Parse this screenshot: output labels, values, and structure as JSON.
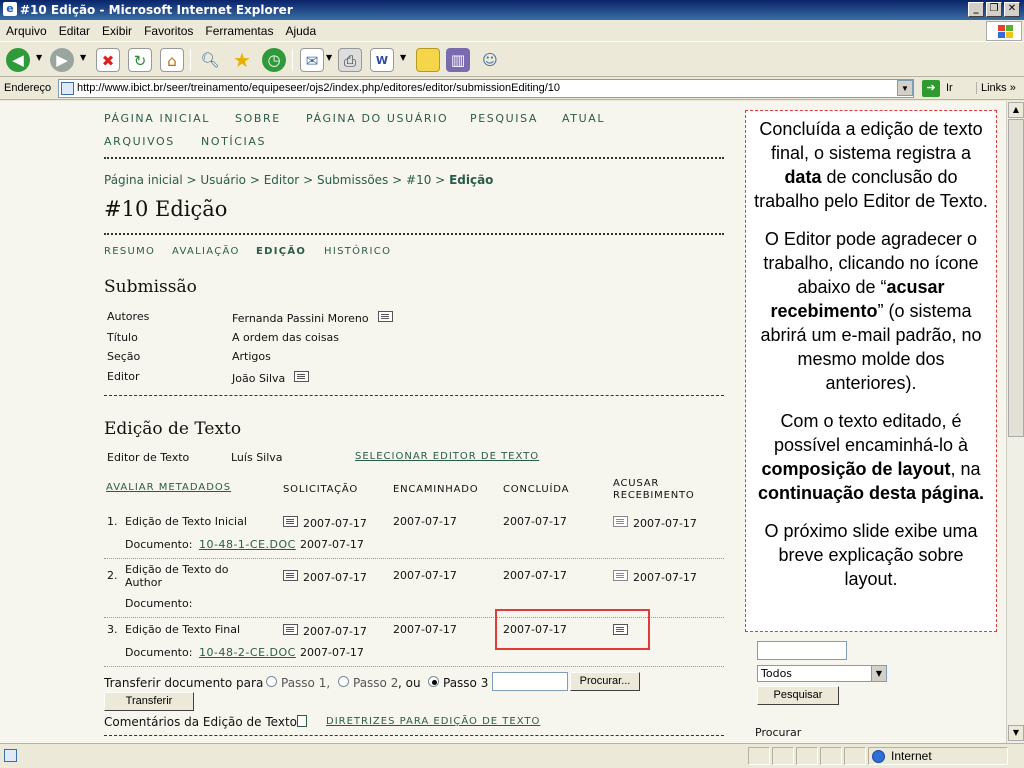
{
  "window": {
    "title": "#10 Edição - Microsoft Internet Explorer"
  },
  "menu": [
    "Arquivo",
    "Editar",
    "Exibir",
    "Favoritos",
    "Ferramentas",
    "Ajuda"
  ],
  "address": {
    "label": "Endereço",
    "url": "http://www.ibict.br/seer/treinamento/equipeseer/ojs2/index.php/editores/editor/submissionEditing/10",
    "go_label": "Ir",
    "links_label": "Links"
  },
  "nav": {
    "row1": [
      "PÁGINA INICIAL",
      "SOBRE",
      "PÁGINA DO USUÁRIO",
      "PESQUISA",
      "ATUAL"
    ],
    "row2": [
      "ARQUIVOS",
      "NOTÍCIAS"
    ]
  },
  "breadcrumb": {
    "items": [
      "Página inicial",
      "Usuário",
      "Editor",
      "Submissões",
      "#10"
    ],
    "current": "Edição",
    "sep": ">"
  },
  "page_title": "#10 Edição",
  "tabs": [
    "RESUMO",
    "AVALIAÇÃO",
    "EDIÇÃO",
    "HISTÓRICO"
  ],
  "submission": {
    "heading": "Submissão",
    "rows": [
      {
        "label": "Autores",
        "value": "Fernanda Passini Moreno"
      },
      {
        "label": "Título",
        "value": "A ordem das coisas"
      },
      {
        "label": "Seção",
        "value": "Artigos"
      },
      {
        "label": "Editor",
        "value": "João Silva"
      }
    ]
  },
  "copyedit": {
    "heading": "Edição de Texto",
    "editor_label": "Editor de Texto",
    "editor_name": "Luís Silva",
    "select_link": "SELECIONAR EDITOR DE TEXTO",
    "review_meta": "AVALIAR METADADOS",
    "columns": {
      "requested": "SOLICITAÇÃO",
      "forwarded": "ENCAMINHADO",
      "completed": "CONCLUÍDA",
      "ack1": "ACUSAR",
      "ack2": "RECEBIMENTO"
    },
    "steps": [
      {
        "num": "1.",
        "title": "Edição de Texto Inicial",
        "requested": "2007-07-17",
        "forwarded": "2007-07-17",
        "completed": "2007-07-17",
        "ack": "2007-07-17",
        "doc_label": "Documento:",
        "doc_link": "10-48-1-CE.DOC",
        "doc_date": "2007-07-17"
      },
      {
        "num": "2.",
        "title": "Edição de Texto do",
        "title2": "Author",
        "requested": "2007-07-17",
        "forwarded": "2007-07-17",
        "completed": "2007-07-17",
        "ack": "2007-07-17",
        "doc_label": "Documento:",
        "doc_link": "",
        "doc_date": ""
      },
      {
        "num": "3.",
        "title": "Edição de Texto Final",
        "requested": "2007-07-17",
        "forwarded": "2007-07-17",
        "completed": "2007-07-17",
        "ack": "",
        "doc_label": "Documento:",
        "doc_link": "10-48-2-CE.DOC",
        "doc_date": "2007-07-17"
      }
    ],
    "transfer": {
      "label": "Transferir documento para",
      "step1": "Passo 1,",
      "step2": "Passo 2",
      "or": ", ou",
      "step3": "Passo 3",
      "browse": "Procurar...",
      "button": "Transferir"
    },
    "comments_label": "Comentários da Edição de Texto",
    "guidelines_link": "DIRETRIZES PARA EDIÇÃO DE TEXTO"
  },
  "sidebar": {
    "select_value": "Todos",
    "search_button": "Pesquisar",
    "browse_heading": "Procurar"
  },
  "annotation": {
    "p1_a": "Concluída a edição de texto final, o sistema registra a ",
    "p1_b": "data",
    "p1_c": " de conclusão do trabalho pelo Editor de Texto.",
    "p2_a": "O Editor pode agradecer o trabalho, clicando no ícone abaixo de “",
    "p2_b": "acusar recebimento",
    "p2_c": "” (o sistema abrirá um e-mail padrão, no mesmo molde dos anteriores).",
    "p3_a": "Com o texto editado, é possível encaminhá-lo à ",
    "p3_b": "composição de layout",
    "p3_c": ", na ",
    "p3_d": "continuação desta página.",
    "p4": "O próximo slide exibe uma breve explicação sobre layout."
  },
  "status": {
    "zone": "Internet"
  }
}
